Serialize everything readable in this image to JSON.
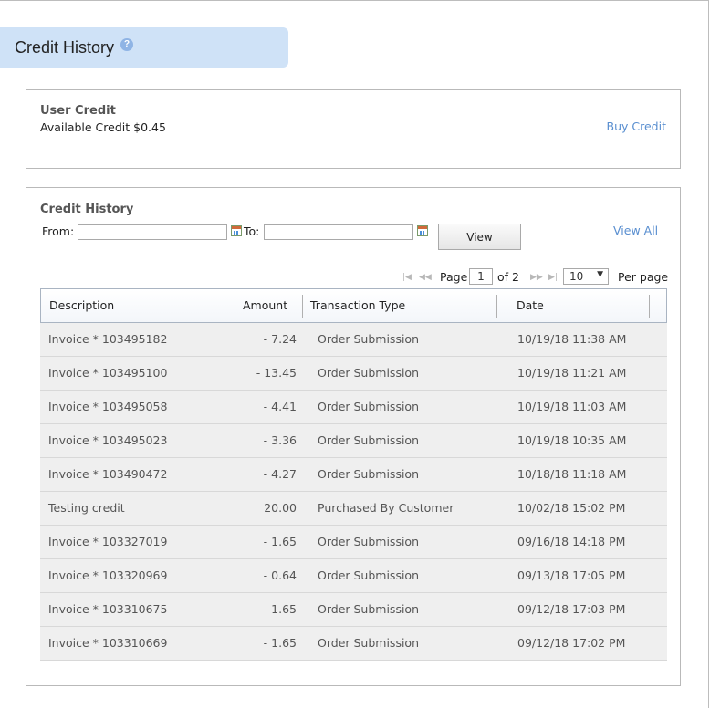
{
  "header": {
    "title": "Credit History",
    "help_icon": "?"
  },
  "user_credit": {
    "title": "User Credit",
    "available": "Available Credit $0.45",
    "buy_link": "Buy Credit"
  },
  "credit_history": {
    "title": "Credit History",
    "from_label": "From:",
    "to_label": "To:",
    "from_value": "",
    "to_value": "",
    "view_button": "View",
    "view_all_link": "View All",
    "pager": {
      "page_label": "Page",
      "current_page": "1",
      "of_label": "of 2",
      "per_page_value": "10",
      "per_page_label": "Per page"
    },
    "columns": [
      "Description",
      "Amount",
      "Transaction Type",
      "Date"
    ],
    "rows": [
      {
        "description": "Invoice * 103495182",
        "amount": "- 7.24",
        "type": "Order Submission",
        "date": "10/19/18 11:38 AM"
      },
      {
        "description": "Invoice * 103495100",
        "amount": "- 13.45",
        "type": "Order Submission",
        "date": "10/19/18 11:21 AM"
      },
      {
        "description": "Invoice * 103495058",
        "amount": "- 4.41",
        "type": "Order Submission",
        "date": "10/19/18 11:03 AM"
      },
      {
        "description": "Invoice * 103495023",
        "amount": "- 3.36",
        "type": "Order Submission",
        "date": "10/19/18 10:35 AM"
      },
      {
        "description": "Invoice * 103490472",
        "amount": "- 4.27",
        "type": "Order Submission",
        "date": "10/18/18 11:18 AM"
      },
      {
        "description": "Testing credit",
        "amount": "20.00",
        "type": "Purchased By Customer",
        "date": "10/02/18 15:02 PM"
      },
      {
        "description": "Invoice * 103327019",
        "amount": "- 1.65",
        "type": "Order Submission",
        "date": "09/16/18 14:18 PM"
      },
      {
        "description": "Invoice * 103320969",
        "amount": "- 0.64",
        "type": "Order Submission",
        "date": "09/13/18 17:05 PM"
      },
      {
        "description": "Invoice * 103310675",
        "amount": "- 1.65",
        "type": "Order Submission",
        "date": "09/12/18 17:03 PM"
      },
      {
        "description": "Invoice * 103310669",
        "amount": "- 1.65",
        "type": "Order Submission",
        "date": "09/12/18 17:02 PM"
      }
    ]
  },
  "colors": {
    "header_bg": "#cfe2f7",
    "link": "#5a8fd0",
    "row_bg": "#efefef"
  }
}
